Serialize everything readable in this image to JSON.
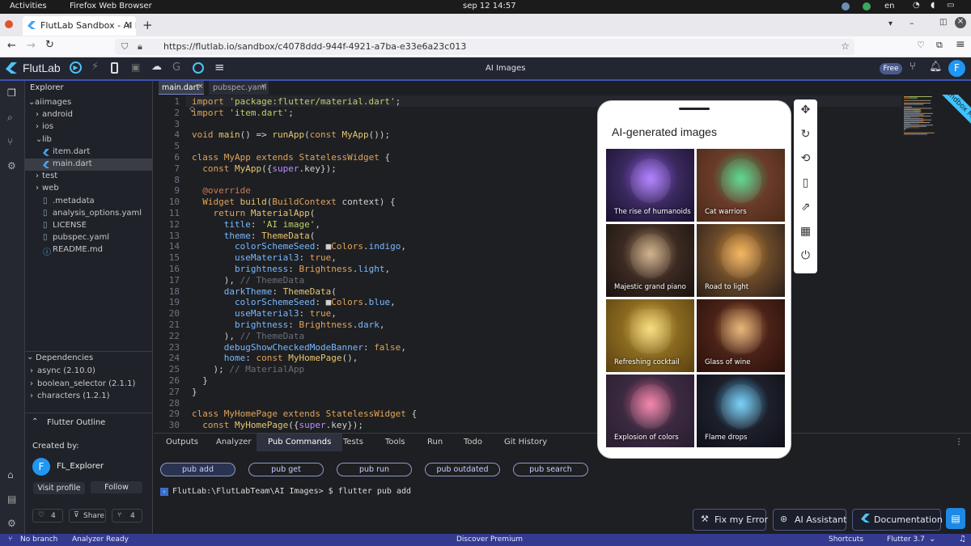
{
  "os_bar": {
    "activities": "Activities",
    "app": "Firefox Web Browser",
    "clock": "sep 12  14:57",
    "lang": "en"
  },
  "browser": {
    "tab_title": "FlutLab Sandbox - AI Ima",
    "url": "https://flutlab.io/sandbox/c4078ddd-944f-4921-a7ba-e33e6a23c013"
  },
  "app_header": {
    "logo": "FlutLab",
    "title": "AI Images",
    "plan_badge": "Free",
    "avatar_letter": "F",
    "ribbon": "Sandbox Mode"
  },
  "explorer": {
    "title": "Explorer",
    "items": [
      {
        "label": "aiimages",
        "kind": "folder-open"
      },
      {
        "label": "android",
        "kind": "folder"
      },
      {
        "label": "ios",
        "kind": "folder"
      },
      {
        "label": "lib",
        "kind": "folder-open"
      },
      {
        "label": "item.dart",
        "kind": "dart"
      },
      {
        "label": "main.dart",
        "kind": "dart"
      },
      {
        "label": "test",
        "kind": "folder"
      },
      {
        "label": "web",
        "kind": "folder"
      },
      {
        "label": ".metadata",
        "kind": "file"
      },
      {
        "label": "analysis_options.yaml",
        "kind": "file"
      },
      {
        "label": "LICENSE",
        "kind": "file"
      },
      {
        "label": "pubspec.yaml",
        "kind": "file"
      },
      {
        "label": "README.md",
        "kind": "info"
      }
    ],
    "deps_title": "Dependencies",
    "deps": [
      "async (2.10.0)",
      "boolean_selector (2.1.1)",
      "characters (1.2.1)"
    ],
    "outline": "Flutter Outline"
  },
  "creator": {
    "created_by": "Created by:",
    "name": "FL_Explorer",
    "avatar_letter": "F",
    "visit": "Visit profile",
    "follow": "Follow",
    "likes": "4",
    "share": "Share",
    "forks": "4"
  },
  "editor": {
    "tabs": [
      "main.dart",
      "pubspec.yaml"
    ],
    "lines": [
      [
        [
          "kw",
          "import "
        ],
        [
          "st",
          "'package:flutter/material.dart'"
        ],
        [
          "pl",
          ";"
        ]
      ],
      [
        [
          "kw",
          "import "
        ],
        [
          "st",
          "'item.dart'"
        ],
        [
          "pl",
          ";"
        ]
      ],
      [],
      [
        [
          "ty",
          "void "
        ],
        [
          "fn",
          "main"
        ],
        [
          "pl",
          "() => "
        ],
        [
          "fn",
          "runApp"
        ],
        [
          "pl",
          "("
        ],
        [
          "kw",
          "const "
        ],
        [
          "fn",
          "MyApp"
        ],
        [
          "pl",
          "());"
        ]
      ],
      [],
      [
        [
          "kw",
          "class "
        ],
        [
          "ty",
          "MyApp "
        ],
        [
          "kw",
          "extends "
        ],
        [
          "ty",
          "StatelessWidget "
        ],
        [
          "pl",
          "{"
        ]
      ],
      [
        [
          "pl",
          "  "
        ],
        [
          "kw",
          "const "
        ],
        [
          "fn",
          "MyApp"
        ],
        [
          "pl",
          "({"
        ],
        [
          "pr",
          "super"
        ],
        [
          "pl",
          ".key});"
        ]
      ],
      [],
      [
        [
          "pl",
          "  "
        ],
        [
          "an",
          "@override"
        ]
      ],
      [
        [
          "pl",
          "  "
        ],
        [
          "ty",
          "Widget "
        ],
        [
          "fn",
          "build"
        ],
        [
          "pl",
          "("
        ],
        [
          "ty",
          "BuildContext "
        ],
        [
          "pl",
          "context) {"
        ]
      ],
      [
        [
          "pl",
          "    "
        ],
        [
          "kw",
          "return "
        ],
        [
          "fn",
          "MaterialApp"
        ],
        [
          "pl",
          "("
        ]
      ],
      [
        [
          "pl",
          "      "
        ],
        [
          "id",
          "title"
        ],
        [
          "pl",
          ": "
        ],
        [
          "st",
          "'AI image'"
        ],
        [
          "pl",
          ","
        ]
      ],
      [
        [
          "pl",
          "      "
        ],
        [
          "id",
          "theme"
        ],
        [
          "pl",
          ": "
        ],
        [
          "fn",
          "ThemeData"
        ],
        [
          "pl",
          "("
        ]
      ],
      [
        [
          "pl",
          "        "
        ],
        [
          "id",
          "colorSchemeSeed"
        ],
        [
          "pl",
          ": ■"
        ],
        [
          "ty",
          "Colors"
        ],
        [
          "pl",
          "."
        ],
        [
          "id",
          "indigo"
        ],
        [
          "pl",
          ","
        ]
      ],
      [
        [
          "pl",
          "        "
        ],
        [
          "id",
          "useMaterial3"
        ],
        [
          "pl",
          ": "
        ],
        [
          "kw",
          "true"
        ],
        [
          "pl",
          ","
        ]
      ],
      [
        [
          "pl",
          "        "
        ],
        [
          "id",
          "brightness"
        ],
        [
          "pl",
          ": "
        ],
        [
          "ty",
          "Brightness"
        ],
        [
          "pl",
          "."
        ],
        [
          "id",
          "light"
        ],
        [
          "pl",
          ","
        ]
      ],
      [
        [
          "pl",
          "      ), "
        ],
        [
          "cm",
          "// ThemeData"
        ]
      ],
      [
        [
          "pl",
          "      "
        ],
        [
          "id",
          "darkTheme"
        ],
        [
          "pl",
          ": "
        ],
        [
          "fn",
          "ThemeData"
        ],
        [
          "pl",
          "("
        ]
      ],
      [
        [
          "pl",
          "        "
        ],
        [
          "id",
          "colorSchemeSeed"
        ],
        [
          "pl",
          ": ■"
        ],
        [
          "ty",
          "Colors"
        ],
        [
          "pl",
          "."
        ],
        [
          "id",
          "blue"
        ],
        [
          "pl",
          ","
        ]
      ],
      [
        [
          "pl",
          "        "
        ],
        [
          "id",
          "useMaterial3"
        ],
        [
          "pl",
          ": "
        ],
        [
          "kw",
          "true"
        ],
        [
          "pl",
          ","
        ]
      ],
      [
        [
          "pl",
          "        "
        ],
        [
          "id",
          "brightness"
        ],
        [
          "pl",
          ": "
        ],
        [
          "ty",
          "Brightness"
        ],
        [
          "pl",
          "."
        ],
        [
          "id",
          "dark"
        ],
        [
          "pl",
          ","
        ]
      ],
      [
        [
          "pl",
          "      ), "
        ],
        [
          "cm",
          "// ThemeData"
        ]
      ],
      [
        [
          "pl",
          "      "
        ],
        [
          "id",
          "debugShowCheckedModeBanner"
        ],
        [
          "pl",
          ": "
        ],
        [
          "kw",
          "false"
        ],
        [
          "pl",
          ","
        ]
      ],
      [
        [
          "pl",
          "      "
        ],
        [
          "id",
          "home"
        ],
        [
          "pl",
          ": "
        ],
        [
          "kw",
          "const "
        ],
        [
          "fn",
          "MyHomePage"
        ],
        [
          "pl",
          "(),"
        ]
      ],
      [
        [
          "pl",
          "    ); "
        ],
        [
          "cm",
          "// MaterialApp"
        ]
      ],
      [
        [
          "pl",
          "  }"
        ]
      ],
      [
        [
          "pl",
          "}"
        ]
      ],
      [],
      [
        [
          "kw",
          "class "
        ],
        [
          "ty",
          "MyHomePage "
        ],
        [
          "kw",
          "extends "
        ],
        [
          "ty",
          "StatelessWidget "
        ],
        [
          "pl",
          "{"
        ]
      ],
      [
        [
          "pl",
          "  "
        ],
        [
          "kw",
          "const "
        ],
        [
          "fn",
          "MyHomePage"
        ],
        [
          "pl",
          "({"
        ],
        [
          "pr",
          "super"
        ],
        [
          "pl",
          ".key});"
        ]
      ]
    ]
  },
  "bottom_panel": {
    "tabs": [
      "Outputs",
      "Analyzer",
      "Pub Commands",
      "Tests",
      "Tools",
      "Run",
      "Todo",
      "Git History"
    ],
    "active_tab": "Pub Commands",
    "commands": [
      "pub add",
      "pub get",
      "pub run",
      "pub outdated",
      "pub search"
    ],
    "terminal": "FlutLab:\\FlutLabTeam\\AI Images> $ flutter pub add"
  },
  "phone": {
    "title": "AI-generated images",
    "tiles": [
      {
        "label": "The rise of humanoids",
        "bg": "#3a2a5e"
      },
      {
        "label": "Cat warriors",
        "bg": "#6b3b2a"
      },
      {
        "label": "Majestic grand piano",
        "bg": "#3b2a22"
      },
      {
        "label": "Road to light",
        "bg": "#6b4a2a"
      },
      {
        "label": "Refreshing cocktail",
        "bg": "#8a6a20"
      },
      {
        "label": "Glass of wine",
        "bg": "#4a2218"
      },
      {
        "label": "Explosion of colors",
        "bg": "#3b2a40"
      },
      {
        "label": "Flame drops",
        "bg": "#1d1f2a"
      }
    ]
  },
  "device_tools": [
    "move-icon",
    "rotate-icon",
    "screen-rotation-icon",
    "device-icon",
    "open-external-icon",
    "qr-code-icon",
    "power-icon"
  ],
  "fabs": {
    "fix": "Fix my Error",
    "ai": "AI Assistant",
    "docs": "Documentation"
  },
  "status_bar": {
    "branch": "No branch",
    "analyzer": "Analyzer Ready",
    "premium": "Discover Premium",
    "shortcuts": "Shortcuts",
    "flutter": "Flutter 3.7"
  },
  "colors": {
    "accent": "#3f51b5",
    "header_bg": "#222631",
    "status_bg": "#343a8f"
  }
}
